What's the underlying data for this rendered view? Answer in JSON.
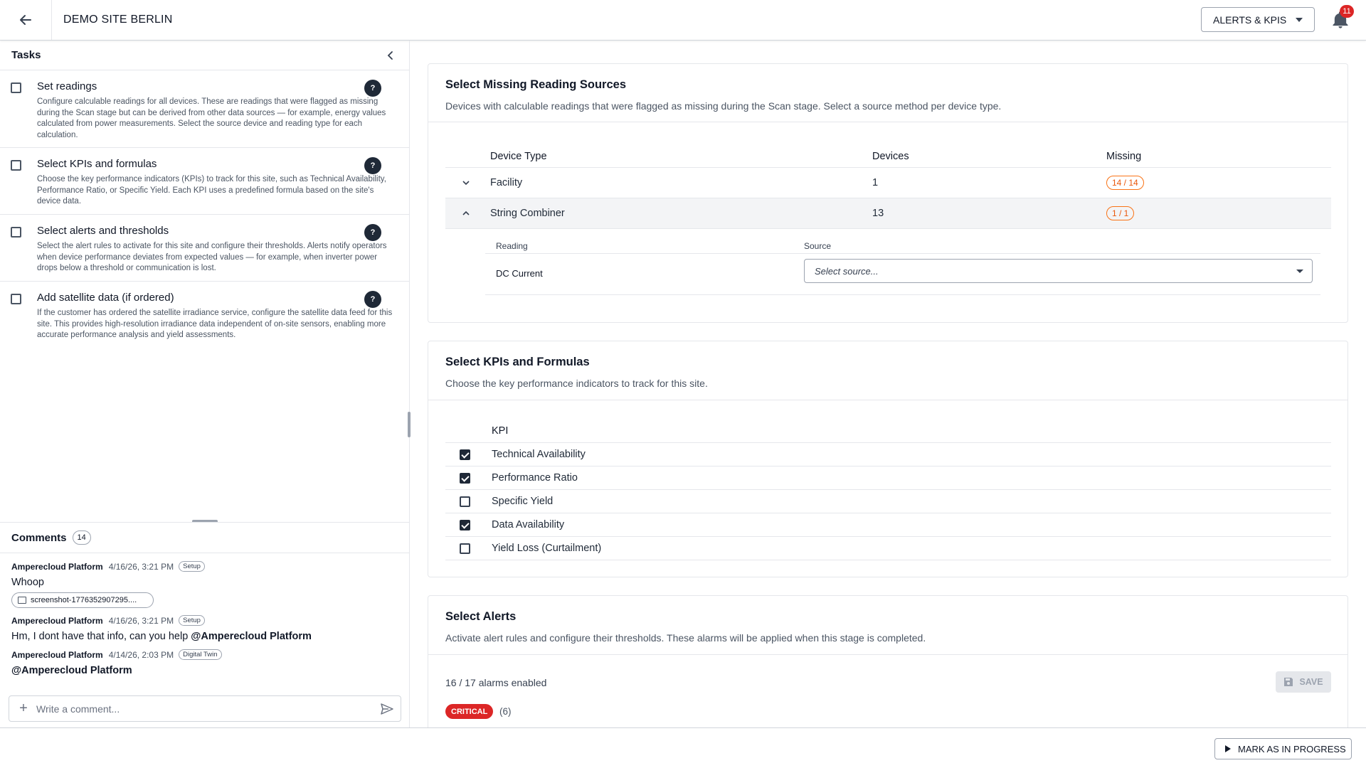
{
  "header": {
    "site_title": "DEMO SITE BERLIN",
    "mode_select": "ALERTS & KPIS",
    "notification_count": "11"
  },
  "tasks": {
    "title": "Tasks",
    "items": [
      {
        "title": "Set readings",
        "description": "Configure calculable readings for all devices. These are readings that were flagged as missing during the Scan stage but can be derived from other data sources — for example, energy values calculated from power measurements. Select the source device and reading type for each calculation.",
        "help": "?"
      },
      {
        "title": "Select KPIs and formulas",
        "description": "Choose the key performance indicators (KPIs) to track for this site, such as Technical Availability, Performance Ratio, or Specific Yield. Each KPI uses a predefined formula based on the site's device data.",
        "help": "?"
      },
      {
        "title": "Select alerts and thresholds",
        "description": "Select the alert rules to activate for this site and configure their thresholds. Alerts notify operators when device performance deviates from expected values — for example, when inverter power drops below a threshold or communication is lost.",
        "help": "?"
      },
      {
        "title": "Add satellite data (if ordered)",
        "description": "If the customer has ordered the satellite irradiance service, configure the satellite data feed for this site. This provides high-resolution irradiance data independent of on-site sensors, enabling more accurate performance analysis and yield assessments.",
        "help": "?"
      }
    ]
  },
  "comments": {
    "title": "Comments",
    "count": "14",
    "items": [
      {
        "author": "Amperecloud Platform",
        "date": "4/16/26, 3:21 PM",
        "tag": "Setup",
        "text": "Whoop",
        "attachment": "screenshot-1776352907295...."
      },
      {
        "author": "Amperecloud Platform",
        "date": "4/16/26, 3:21 PM",
        "tag": "Setup",
        "text": "Hm, I dont have that info, can you help ",
        "mention": "@Amperecloud Platform"
      },
      {
        "author": "Amperecloud Platform",
        "date": "4/14/26, 2:03 PM",
        "tag": "Digital Twin",
        "mention": "@Amperecloud Platform"
      }
    ],
    "input_placeholder": "Write a comment..."
  },
  "missing_sources": {
    "title": "Select Missing Reading Sources",
    "subtitle": "Devices with calculable readings that were flagged as missing during the Scan stage. Select a source method per device type.",
    "columns": [
      "Device Type",
      "Devices",
      "Missing"
    ],
    "rows": [
      {
        "device_type": "Facility",
        "devices": "1",
        "missing": "14 / 14",
        "expanded": false
      },
      {
        "device_type": "String Combiner",
        "devices": "13",
        "missing": "1 / 1",
        "expanded": true
      }
    ],
    "sub_columns": [
      "Reading",
      "Source"
    ],
    "sub_rows": [
      {
        "reading": "DC Current",
        "source_placeholder": "Select source..."
      }
    ]
  },
  "kpis": {
    "title": "Select KPIs and Formulas",
    "subtitle": "Choose the key performance indicators to track for this site.",
    "column": "KPI",
    "items": [
      {
        "label": "Technical Availability",
        "checked": true
      },
      {
        "label": "Performance Ratio",
        "checked": true
      },
      {
        "label": "Specific Yield",
        "checked": false
      },
      {
        "label": "Data Availability",
        "checked": true
      },
      {
        "label": "Yield Loss (Curtailment)",
        "checked": false
      }
    ]
  },
  "alerts": {
    "title": "Select Alerts",
    "subtitle": "Activate alert rules and configure their thresholds. These alarms will be applied when this stage is completed.",
    "enabled_summary": "16 / 17 alarms enabled",
    "save_label": "SAVE",
    "critical_label": "CRITICAL",
    "critical_count": "(6)"
  },
  "footer": {
    "mark_button": "MARK AS IN PROGRESS"
  },
  "colors": {
    "accent_dark": "#1f2937",
    "missing_orange": "#ea580c",
    "critical_red": "#dc2626"
  }
}
